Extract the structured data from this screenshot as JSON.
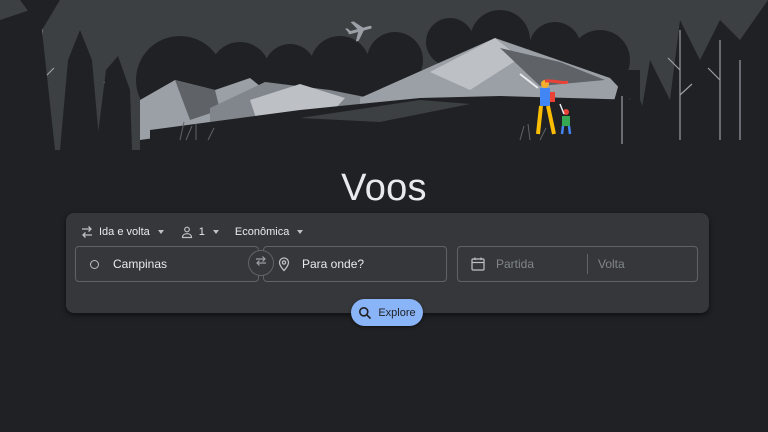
{
  "page": {
    "title": "Voos"
  },
  "search": {
    "trip_type": "Ida e volta",
    "passengers": "1",
    "cabin_class": "Econômica",
    "origin": "Campinas",
    "destination_placeholder": "Para onde?",
    "departure_placeholder": "Partida",
    "return_placeholder": "Volta",
    "explore_label": "Explore"
  },
  "icons": {
    "trip_type": "swap-arrows-icon",
    "passengers": "person-icon",
    "origin": "circle-icon",
    "swap": "swap-icon",
    "destination": "location-pin-icon",
    "calendar": "calendar-icon",
    "explore": "search-icon",
    "hero": "mountain-landscape-illustration"
  },
  "colors": {
    "background": "#202124",
    "card": "#36373a",
    "accent": "#8ab4f8",
    "text": "#e8eaed",
    "placeholder": "#80868b"
  }
}
